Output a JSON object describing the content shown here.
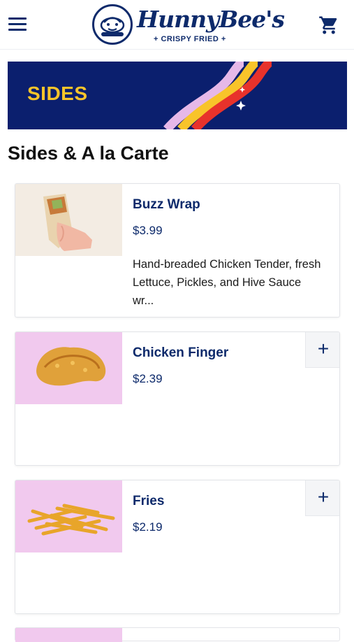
{
  "header": {
    "brand_name": "HunnyBee's",
    "brand_tagline": "+ CRISPY FRIED +",
    "menu_icon": "hamburger-menu-icon",
    "cart_icon": "shopping-cart-icon"
  },
  "banner": {
    "title": "SIDES",
    "colors": {
      "background": "#0b1f6e",
      "title": "#f8c42a",
      "stripes": [
        "#e6b8e8",
        "#f8c42a",
        "#e8322b"
      ]
    }
  },
  "section": {
    "title": "Sides & A la Carte"
  },
  "items": [
    {
      "name": "Buzz Wrap",
      "price": "$3.99",
      "description": "Hand-breaded Chicken Tender, fresh Lettuce, Pickles, and Hive Sauce wr...",
      "add_label": ""
    },
    {
      "name": "Chicken Finger",
      "price": "$2.39",
      "description": "",
      "add_label": "+"
    },
    {
      "name": "Fries",
      "price": "$2.19",
      "description": "",
      "add_label": "+"
    }
  ],
  "colors": {
    "brand_navy": "#0d2a6b",
    "image_pink": "#f1c9ee"
  }
}
